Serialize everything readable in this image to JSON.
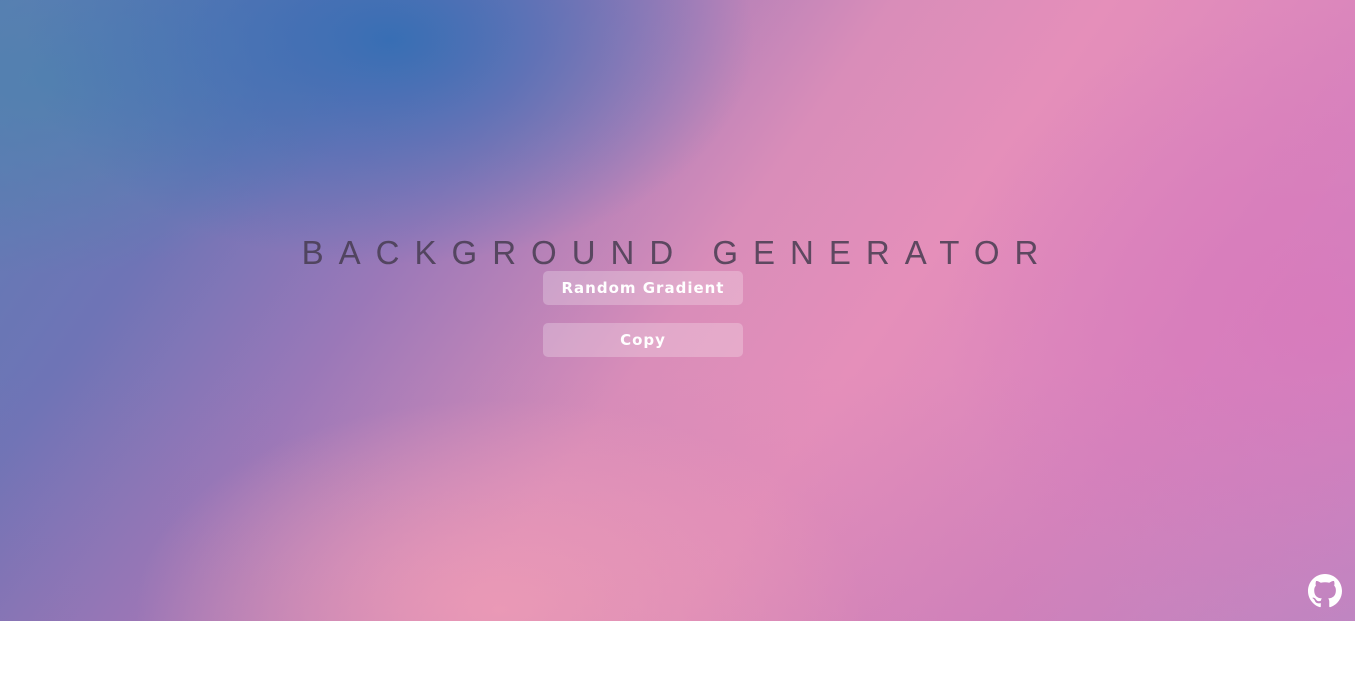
{
  "page": {
    "title": "BACKGROUND GENERATOR"
  },
  "buttons": {
    "random_label": "Random Gradient",
    "copy_label": "Copy"
  },
  "footer": {
    "github_icon": "github-icon"
  },
  "colors": {
    "gradient_blue": "#346eb4",
    "gradient_pink": "#f6a0b8",
    "gradient_magenta": "#d87abc",
    "title_color": "#463c50",
    "button_text": "#ffffff"
  }
}
